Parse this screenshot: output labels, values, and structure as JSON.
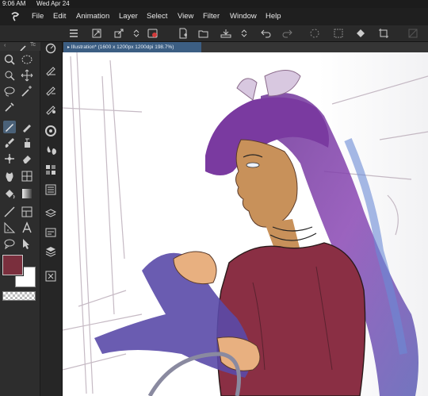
{
  "status": {
    "time": "9:06 AM",
    "date": "Wed Apr 24"
  },
  "menu": [
    "File",
    "Edit",
    "Animation",
    "Layer",
    "Select",
    "View",
    "Filter",
    "Window",
    "Help"
  ],
  "panel_tab_label": "Tc",
  "document_tab": "Illustration* (1600 x 1200px 1200dpi 198.7%)",
  "colors": {
    "main": "#7a2f3d",
    "sub": "#ffffff",
    "accent": "#3c5e83"
  }
}
